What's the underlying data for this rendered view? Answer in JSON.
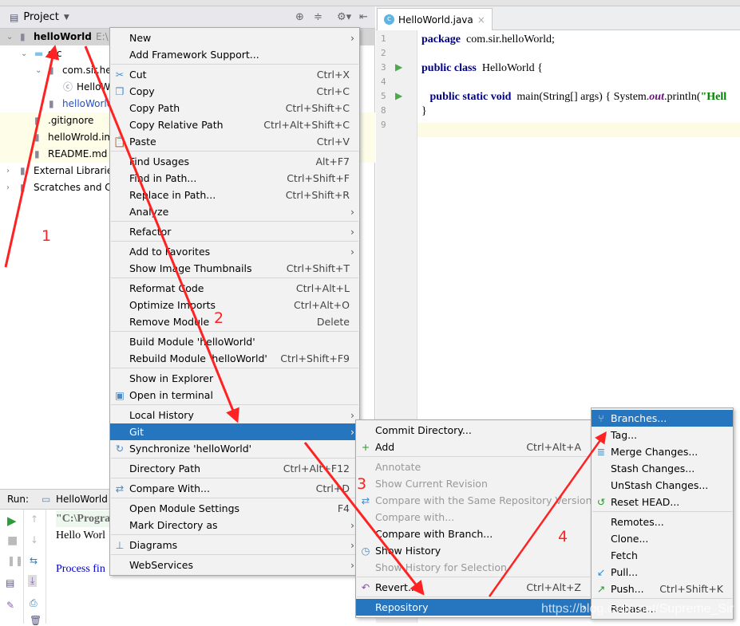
{
  "project": {
    "title": "Project",
    "tree": [
      {
        "label": "helloWorld",
        "extra": "E:\\",
        "indent": 0,
        "icon": "module-folder-icon",
        "bold": true,
        "sel": true,
        "chev": "v"
      },
      {
        "label": "src",
        "indent": 1,
        "icon": "folder-icon",
        "chev": "v"
      },
      {
        "label": "com.sir.he",
        "indent": 2,
        "icon": "package-icon",
        "chev": "v"
      },
      {
        "label": "HelloW",
        "indent": 3,
        "icon": "java-class-icon"
      },
      {
        "label": "helloWorld.im",
        "indent": 2,
        "icon": "iml-file-icon",
        "blue": true
      },
      {
        "label": ".gitignore",
        "indent": 1,
        "icon": "text-file-icon",
        "yel": true
      },
      {
        "label": "helloWrold.iml",
        "indent": 1,
        "icon": "iml-file-icon",
        "yel": true
      },
      {
        "label": "README.md",
        "indent": 1,
        "icon": "markdown-file-icon",
        "yel": true
      },
      {
        "label": "External Librarie",
        "indent": 0,
        "icon": "library-icon",
        "chev": ">"
      },
      {
        "label": "Scratches and C",
        "indent": 0,
        "icon": "scratches-icon",
        "chev": ">"
      }
    ]
  },
  "editor": {
    "tab": "HelloWorld.java",
    "lines": [
      {
        "n": "1",
        "code": [
          [
            "kw",
            "package"
          ],
          [
            "",
            "  com.sir.helloWorld;"
          ]
        ]
      },
      {
        "n": "2",
        "code": []
      },
      {
        "n": "3",
        "code": [
          [
            "kw",
            "public class"
          ],
          [
            "",
            "  HelloWorld {"
          ]
        ],
        "run": true
      },
      {
        "n": "4",
        "code": []
      },
      {
        "n": "5",
        "code": [
          [
            "",
            "   "
          ],
          [
            "kw",
            "public static void"
          ],
          [
            "",
            "  main(String[] args) { System."
          ],
          [
            "out",
            "out"
          ],
          [
            "",
            ".println("
          ],
          [
            "str",
            "\"Hell"
          ]
        ],
        "run": true
      },
      {
        "n": "8",
        "code": [
          [
            "",
            "}"
          ]
        ]
      },
      {
        "n": "9",
        "code": []
      }
    ]
  },
  "run": {
    "label": "Run:",
    "tab": "HelloWorld",
    "lines": [
      "\"C:\\Progra",
      "Hello Worl",
      "",
      "Process fin"
    ]
  },
  "main_menu": [
    {
      "label": "New",
      "arrow": true
    },
    {
      "label": "Add Framework Support..."
    },
    {
      "sep": true
    },
    {
      "label": "Cut",
      "sc": "Ctrl+X",
      "icon": "✂"
    },
    {
      "label": "Copy",
      "sc": "Ctrl+C",
      "icon": "❐"
    },
    {
      "label": "Copy Path",
      "sc": "Ctrl+Shift+C"
    },
    {
      "label": "Copy Relative Path",
      "sc": "Ctrl+Alt+Shift+C"
    },
    {
      "label": "Paste",
      "sc": "Ctrl+V",
      "icon": "📋"
    },
    {
      "sep": true
    },
    {
      "label": "Find Usages",
      "sc": "Alt+F7"
    },
    {
      "label": "Find in Path...",
      "sc": "Ctrl+Shift+F"
    },
    {
      "label": "Replace in Path...",
      "sc": "Ctrl+Shift+R"
    },
    {
      "label": "Analyze",
      "arrow": true
    },
    {
      "sep": true
    },
    {
      "label": "Refactor",
      "arrow": true
    },
    {
      "sep": true
    },
    {
      "label": "Add to Favorites",
      "arrow": true
    },
    {
      "label": "Show Image Thumbnails",
      "sc": "Ctrl+Shift+T"
    },
    {
      "sep": true
    },
    {
      "label": "Reformat Code",
      "sc": "Ctrl+Alt+L"
    },
    {
      "label": "Optimize Imports",
      "sc": "Ctrl+Alt+O"
    },
    {
      "label": "Remove Module",
      "sc": "Delete"
    },
    {
      "sep": true
    },
    {
      "label": "Build Module 'helloWorld'"
    },
    {
      "label": "Rebuild Module 'helloWorld'",
      "sc": "Ctrl+Shift+F9"
    },
    {
      "sep": true
    },
    {
      "label": "Show in Explorer"
    },
    {
      "label": "Open in terminal",
      "icon": "▣"
    },
    {
      "sep": true
    },
    {
      "label": "Local History",
      "arrow": true
    },
    {
      "label": "Git",
      "arrow": true,
      "sel": true
    },
    {
      "label": "Synchronize 'helloWorld'",
      "icon": "↻"
    },
    {
      "sep": true
    },
    {
      "label": "Directory Path",
      "sc": "Ctrl+Alt+F12"
    },
    {
      "sep": true
    },
    {
      "label": "Compare With...",
      "sc": "Ctrl+D",
      "icon": "⇄"
    },
    {
      "sep": true
    },
    {
      "label": "Open Module Settings",
      "sc": "F4"
    },
    {
      "label": "Mark Directory as",
      "arrow": true
    },
    {
      "sep": true
    },
    {
      "label": "Diagrams",
      "arrow": true,
      "icon": "⊥"
    },
    {
      "sep": true
    },
    {
      "label": "WebServices",
      "arrow": true
    }
  ],
  "git_menu": [
    {
      "label": "Commit Directory..."
    },
    {
      "label": "Add",
      "sc": "Ctrl+Alt+A",
      "icon": "+",
      "iconColor": "#2a9a2a"
    },
    {
      "sep": true
    },
    {
      "label": "Annotate",
      "dis": true
    },
    {
      "label": "Show Current Revision",
      "dis": true
    },
    {
      "label": "Compare with the Same Repository Version",
      "dis": true,
      "icon": "⇄"
    },
    {
      "label": "Compare with...",
      "dis": true
    },
    {
      "label": "Compare with Branch..."
    },
    {
      "label": "Show History",
      "icon": "◷"
    },
    {
      "label": "Show History for Selection",
      "dis": true
    },
    {
      "sep": true
    },
    {
      "label": "Revert...",
      "sc": "Ctrl+Alt+Z",
      "icon": "↶",
      "iconColor": "#8a4fb0"
    },
    {
      "sep": true
    },
    {
      "label": "Repository",
      "arrow": true,
      "sel": true
    }
  ],
  "repo_menu": [
    {
      "label": "Branches...",
      "sel": true,
      "icon": "⑂"
    },
    {
      "label": "Tag..."
    },
    {
      "label": "Merge Changes...",
      "icon": "≣"
    },
    {
      "label": "Stash Changes..."
    },
    {
      "label": "UnStash Changes..."
    },
    {
      "label": "Reset HEAD...",
      "icon": "↺",
      "iconColor": "#2a9a2a"
    },
    {
      "sep": true
    },
    {
      "label": "Remotes..."
    },
    {
      "label": "Clone..."
    },
    {
      "label": "Fetch"
    },
    {
      "label": "Pull...",
      "icon": "↙",
      "iconColor": "#2a8fd8"
    },
    {
      "label": "Push...",
      "sc": "Ctrl+Shift+K",
      "icon": "↗",
      "iconColor": "#2a9a2a"
    },
    {
      "sep": true
    },
    {
      "label": "Rebase..."
    }
  ],
  "annotations": [
    "1",
    "2",
    "3",
    "4"
  ],
  "watermark": "https://blog.csdn.net/Supreme_Sir",
  "colors": {
    "selection": "#2675bf",
    "arrow": "#ff2222",
    "keyword": "#000080"
  }
}
